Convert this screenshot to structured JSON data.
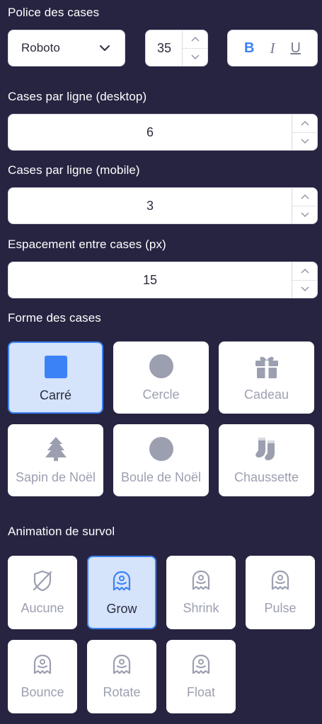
{
  "font_section": {
    "label": "Police des cases",
    "font_select": "Roboto",
    "font_size": "35",
    "bold": "B",
    "italic": "I",
    "underline": "U"
  },
  "desktop": {
    "label": "Cases par ligne (desktop)",
    "value": "6"
  },
  "mobile": {
    "label": "Cases par ligne (mobile)",
    "value": "3"
  },
  "spacing": {
    "label": "Espacement entre cases (px)",
    "value": "15"
  },
  "shape": {
    "label": "Forme des cases",
    "selected": "Carré",
    "options": [
      {
        "label": "Carré",
        "icon": "square-icon"
      },
      {
        "label": "Cercle",
        "icon": "circle-icon"
      },
      {
        "label": "Cadeau",
        "icon": "gift-icon"
      },
      {
        "label": "Sapin de Noël",
        "icon": "tree-icon"
      },
      {
        "label": "Boule de Noël",
        "icon": "ornament-icon"
      },
      {
        "label": "Chaussette",
        "icon": "socks-icon"
      }
    ]
  },
  "animation": {
    "label": "Animation de survol",
    "selected": "Grow",
    "options": [
      {
        "label": "Aucune",
        "icon": "ban-icon"
      },
      {
        "label": "Grow",
        "icon": "ghost-icon"
      },
      {
        "label": "Shrink",
        "icon": "ghost-icon"
      },
      {
        "label": "Pulse",
        "icon": "ghost-icon"
      },
      {
        "label": "Bounce",
        "icon": "ghost-icon"
      },
      {
        "label": "Rotate",
        "icon": "ghost-icon"
      },
      {
        "label": "Float",
        "icon": "ghost-icon"
      }
    ]
  },
  "colors": {
    "background": "#262441",
    "accent": "#3b82f6",
    "selected_bg": "#d5e3fb",
    "muted_icon": "#9c9fb0"
  }
}
